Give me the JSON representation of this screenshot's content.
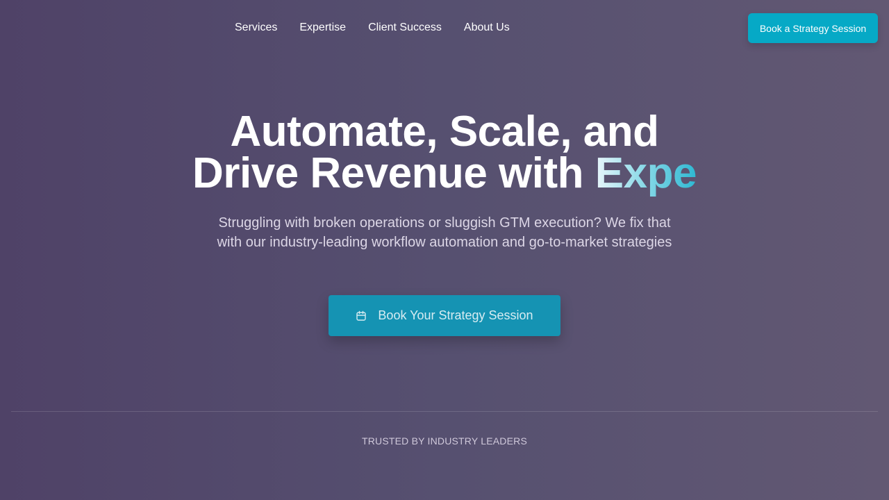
{
  "nav": {
    "links": [
      {
        "label": "Services"
      },
      {
        "label": "Expertise"
      },
      {
        "label": "Client Success"
      },
      {
        "label": "About Us"
      }
    ],
    "cta_label": "Book a Strategy Session"
  },
  "hero": {
    "title_line1": "Automate, Scale, and",
    "title_line2": "Drive Revenue with ",
    "title_accent": "Expe",
    "subtitle": "Struggling with broken operations or sluggish GTM execution? We fix that with our industry-leading workflow automation and go-to-market strategies",
    "cta_label": "Book Your Strategy Session",
    "cta_icon": "calendar-icon"
  },
  "trusted": {
    "label": "TRUSTED BY INDUSTRY LEADERS"
  },
  "colors": {
    "accent": "#06a9c6",
    "cta_button": "#1593b3",
    "background_start": "#4f4267",
    "background_end": "#625873"
  }
}
